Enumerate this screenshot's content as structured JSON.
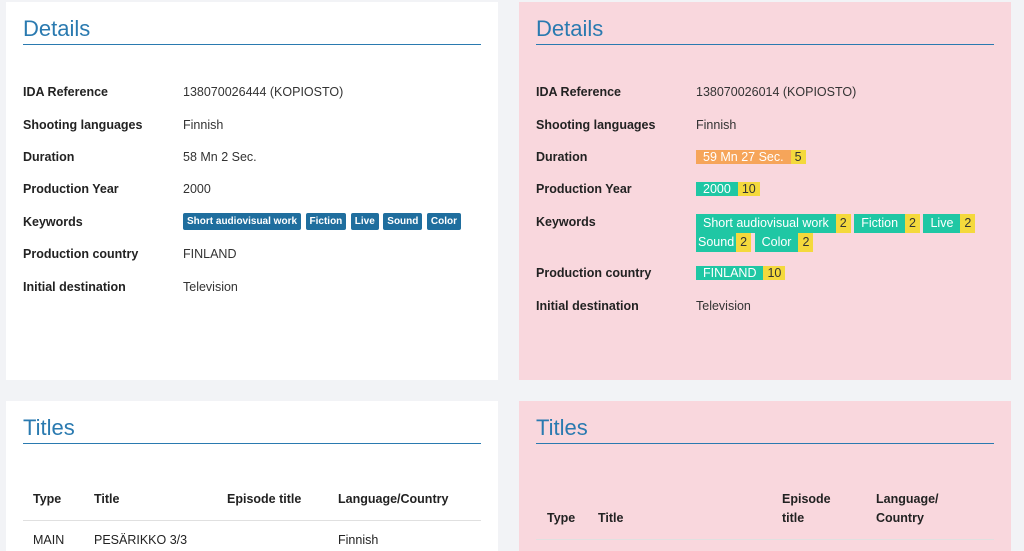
{
  "left": {
    "details": {
      "heading": "Details",
      "ida_label": "IDA Reference",
      "ida_value": "138070026444 (KOPIOSTO)",
      "lang_label": "Shooting languages",
      "lang_value": "Finnish",
      "duration_label": "Duration",
      "duration_value": "58 Mn 2 Sec.",
      "year_label": "Production Year",
      "year_value": "2000",
      "keywords_label": "Keywords",
      "keywords": [
        "Short audiovisual work",
        "Fiction",
        "Live",
        "Sound",
        "Color"
      ],
      "country_label": "Production country",
      "country_value": "FINLAND",
      "dest_label": "Initial destination",
      "dest_value": "Television"
    },
    "titles": {
      "heading": "Titles",
      "col_type": "Type",
      "col_title": "Title",
      "col_episode": "Episode title",
      "col_lang": "Language/Country",
      "row1_type": "MAIN",
      "row1_title": "PESÄRIKKO 3/3",
      "row1_lang": "Finnish"
    }
  },
  "right": {
    "details": {
      "heading": "Details",
      "ida_label": "IDA Reference",
      "ida_value": "138070026014 (KOPIOSTO)",
      "lang_label": "Shooting languages",
      "lang_value": "Finnish",
      "duration_label": "Duration",
      "duration_value": "59 Mn 27 Sec.",
      "duration_score": "5",
      "year_label": "Production Year",
      "year_value": "2000",
      "year_score": "10",
      "keywords_label": "Keywords",
      "kw1": "Short audiovisual work",
      "kw1_score": "2",
      "kw2": "Fiction",
      "kw2_score": "2",
      "kw3": "Live",
      "kw3_score": "2",
      "kw4": "Sound",
      "kw4_score": "2",
      "kw5": "Color",
      "kw5_score": "2",
      "country_label": "Production country",
      "country_value": "FINLAND",
      "country_score": "10",
      "dest_label": "Initial destination",
      "dest_value": "Television"
    },
    "titles": {
      "heading": "Titles",
      "col_type": "Type",
      "col_title": "Title",
      "col_episode_1": "Episode",
      "col_episode_2": "title",
      "col_lang_1": "Language/",
      "col_lang_2": "Country"
    }
  },
  "colors": {
    "heading": "#2a7ab0",
    "tag_blue": "#1f6e9e",
    "match_green": "#1fc7a4",
    "diff_orange": "#f6a55a",
    "score_yellow": "#f4d93c",
    "pink_bg": "#f9d7dd"
  }
}
